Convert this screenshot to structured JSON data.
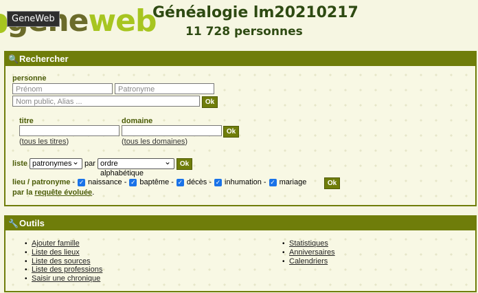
{
  "header": {
    "logo_part1": "gene",
    "logo_part2": "web",
    "tooltip": "GeneWeb",
    "title": "Généalogie lm20210217",
    "count": "11 728 personnes"
  },
  "search": {
    "heading": "Rechercher",
    "person_label": "personne",
    "firstname_placeholder": "Prénom",
    "surname_placeholder": "Patronyme",
    "public_placeholder": "Nom public, Alias  ...",
    "ok": "Ok",
    "title_label": "titre",
    "domain_label": "domaine",
    "all_titles_open": "(",
    "all_titles": "tous les titres",
    "all_titles_close": ")",
    "all_domains_open": "(",
    "all_domains": "tous les domaines",
    "all_domains_close": ")",
    "list_label": "liste",
    "list_select": "patronymes",
    "by_label": "par",
    "order_select": "ordre alphabétique",
    "place_label": "lieu / patronyme",
    "dash": "-",
    "events": [
      "naissance",
      "baptême",
      "décès",
      "inhumation",
      "mariage"
    ],
    "advanced_prefix": "par la",
    "advanced_link": "requête évoluée",
    "advanced_suffix": "."
  },
  "tools": {
    "heading": "Outils",
    "left_items": [
      "Ajouter famille",
      "Liste des lieux",
      "Liste des sources",
      "Liste des professions",
      "Saisir une chronique"
    ],
    "right_items": [
      "Statistiques",
      "Anniversaires",
      "Calendriers"
    ]
  },
  "colors": {
    "accent": "#6f7d0a",
    "label": "#4b5c08",
    "background": "#f6f6e2",
    "title": "#2e4a12"
  }
}
